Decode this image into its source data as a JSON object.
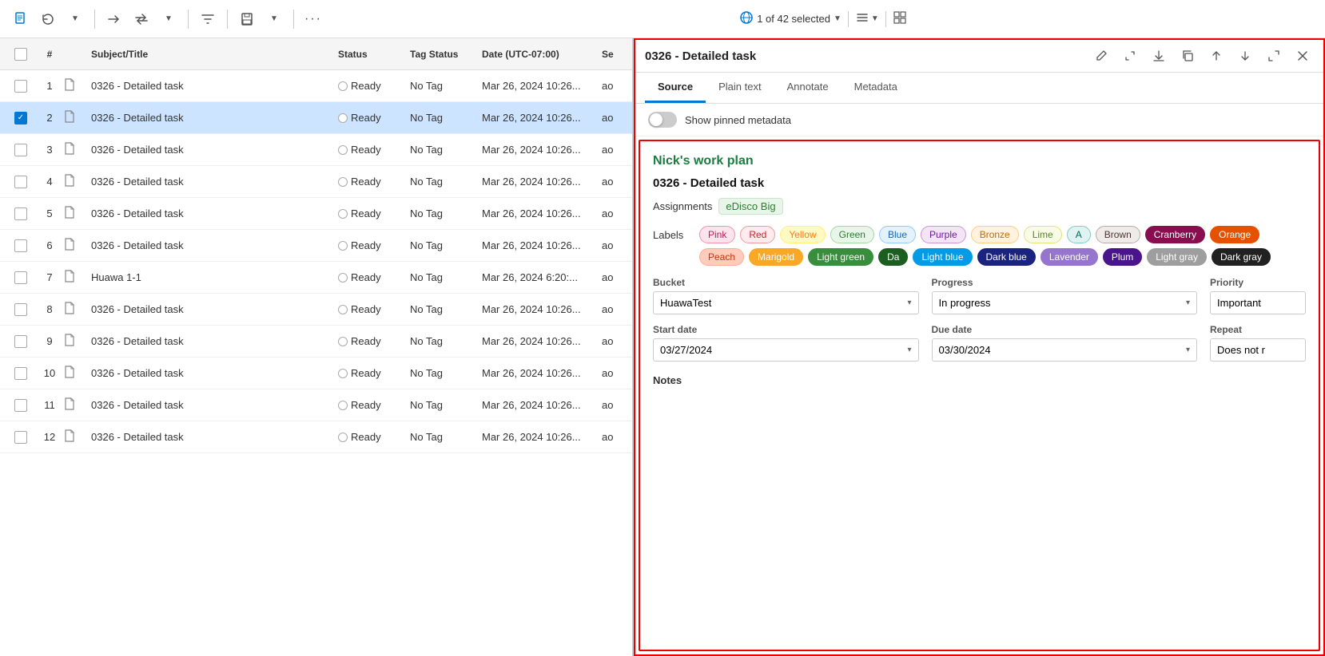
{
  "toolbar": {
    "selection_info": "1 of 42 selected",
    "icons": [
      "📄",
      "🔄",
      "→",
      "↔",
      "💧",
      "📋",
      "⋯"
    ]
  },
  "right_panel": {
    "title": "0326 - Detailed task",
    "tabs": [
      "Source",
      "Plain text",
      "Annotate",
      "Metadata"
    ],
    "active_tab": "Source",
    "pinned_label": "Show pinned metadata",
    "content": {
      "work_plan": "Nick's work plan",
      "task_title": "0326 - Detailed task",
      "assignments_label": "Assignments",
      "assignments_value": "eDisco Big",
      "labels_label": "Labels",
      "labels": [
        {
          "text": "Pink",
          "bg": "#fce4ec",
          "color": "#c2185b",
          "border": "#f48fb1"
        },
        {
          "text": "Red",
          "bg": "#ffebee",
          "color": "#c62828",
          "border": "#ef9a9a"
        },
        {
          "text": "Yellow",
          "bg": "#fff9c4",
          "color": "#f57f17",
          "border": "#fff176"
        },
        {
          "text": "Green",
          "bg": "#e8f5e9",
          "color": "#2e7d32",
          "border": "#a5d6a7"
        },
        {
          "text": "Blue",
          "bg": "#e3f2fd",
          "color": "#1565c0",
          "border": "#90caf9"
        },
        {
          "text": "Purple",
          "bg": "#f3e5f5",
          "color": "#6a1b9a",
          "border": "#ce93d8"
        },
        {
          "text": "Bronze",
          "bg": "#fff3e0",
          "color": "#bf6c00",
          "border": "#ffcc80"
        },
        {
          "text": "Lime",
          "bg": "#f9fbe7",
          "color": "#558b2f",
          "border": "#dce775"
        },
        {
          "text": "A",
          "bg": "#e0f2f1",
          "color": "#00695c",
          "border": "#80cbc4"
        },
        {
          "text": "Brown",
          "bg": "#efebe9",
          "color": "#4e342e",
          "border": "#bcaaa4"
        },
        {
          "text": "Cranberry",
          "bg": "#880e4f",
          "color": "#fff",
          "border": "#880e4f"
        },
        {
          "text": "Orange",
          "bg": "#e65100",
          "color": "#fff",
          "border": "#e65100"
        },
        {
          "text": "Peach",
          "bg": "#ffccbc",
          "color": "#bf360c",
          "border": "#ffab91"
        },
        {
          "text": "Marigold",
          "bg": "#f9a825",
          "color": "#fff",
          "border": "#f9a825"
        },
        {
          "text": "Light green",
          "bg": "#388e3c",
          "color": "#fff",
          "border": "#388e3c"
        },
        {
          "text": "Da",
          "bg": "#1b5e20",
          "color": "#fff",
          "border": "#1b5e20"
        },
        {
          "text": "Light blue",
          "bg": "#039be5",
          "color": "#fff",
          "border": "#039be5"
        },
        {
          "text": "Dark blue",
          "bg": "#1a237e",
          "color": "#fff",
          "border": "#1a237e"
        },
        {
          "text": "Lavender",
          "bg": "#9575cd",
          "color": "#fff",
          "border": "#9575cd"
        },
        {
          "text": "Plum",
          "bg": "#4a148c",
          "color": "#fff",
          "border": "#4a148c"
        },
        {
          "text": "Light gray",
          "bg": "#9e9e9e",
          "color": "#fff",
          "border": "#9e9e9e"
        },
        {
          "text": "Dark gray",
          "bg": "#212121",
          "color": "#fff",
          "border": "#212121"
        }
      ],
      "bucket_label": "Bucket",
      "bucket_value": "HuawaTest",
      "progress_label": "Progress",
      "progress_value": "In progress",
      "priority_label": "Priority",
      "priority_value": "Important",
      "start_date_label": "Start date",
      "start_date_value": "03/27/2024",
      "due_date_label": "Due date",
      "due_date_value": "03/30/2024",
      "repeat_label": "Repeat",
      "repeat_value": "Does not r",
      "notes_label": "Notes"
    }
  },
  "table": {
    "headers": [
      "",
      "#",
      "",
      "Subject/Title",
      "Status",
      "Tag Status",
      "Date (UTC-07:00)",
      "Se"
    ],
    "rows": [
      {
        "num": 1,
        "title": "0326 - Detailed task",
        "status": "Ready",
        "tag": "No Tag",
        "date": "Mar 26, 2024 10:26...",
        "se": "ao",
        "selected": false
      },
      {
        "num": 2,
        "title": "0326 - Detailed task",
        "status": "Ready",
        "tag": "No Tag",
        "date": "Mar 26, 2024 10:26...",
        "se": "ao",
        "selected": true
      },
      {
        "num": 3,
        "title": "0326 - Detailed task",
        "status": "Ready",
        "tag": "No Tag",
        "date": "Mar 26, 2024 10:26...",
        "se": "ao",
        "selected": false
      },
      {
        "num": 4,
        "title": "0326 - Detailed task",
        "status": "Ready",
        "tag": "No Tag",
        "date": "Mar 26, 2024 10:26...",
        "se": "ao",
        "selected": false
      },
      {
        "num": 5,
        "title": "0326 - Detailed task",
        "status": "Ready",
        "tag": "No Tag",
        "date": "Mar 26, 2024 10:26...",
        "se": "ao",
        "selected": false
      },
      {
        "num": 6,
        "title": "0326 - Detailed task",
        "status": "Ready",
        "tag": "No Tag",
        "date": "Mar 26, 2024 10:26...",
        "se": "ao",
        "selected": false
      },
      {
        "num": 7,
        "title": "Huawa 1-1",
        "status": "Ready",
        "tag": "No Tag",
        "date": "Mar 26, 2024 6:20:...",
        "se": "ao",
        "selected": false
      },
      {
        "num": 8,
        "title": "0326 - Detailed task",
        "status": "Ready",
        "tag": "No Tag",
        "date": "Mar 26, 2024 10:26...",
        "se": "ao",
        "selected": false
      },
      {
        "num": 9,
        "title": "0326 - Detailed task",
        "status": "Ready",
        "tag": "No Tag",
        "date": "Mar 26, 2024 10:26...",
        "se": "ao",
        "selected": false
      },
      {
        "num": 10,
        "title": "0326 - Detailed task",
        "status": "Ready",
        "tag": "No Tag",
        "date": "Mar 26, 2024 10:26...",
        "se": "ao",
        "selected": false
      },
      {
        "num": 11,
        "title": "0326 - Detailed task",
        "status": "Ready",
        "tag": "No Tag",
        "date": "Mar 26, 2024 10:26...",
        "se": "ao",
        "selected": false
      },
      {
        "num": 12,
        "title": "0326 - Detailed task",
        "status": "Ready",
        "tag": "No Tag",
        "date": "Mar 26, 2024 10:26...",
        "se": "ao",
        "selected": false
      }
    ]
  }
}
